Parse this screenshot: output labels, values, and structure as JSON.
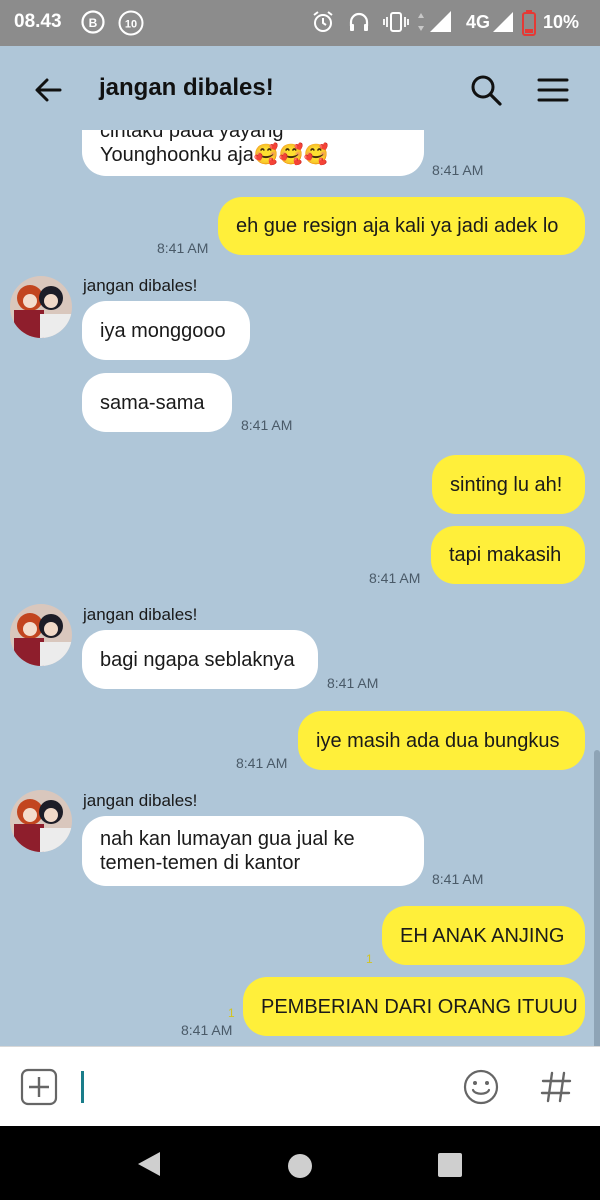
{
  "status_bar": {
    "time": "08.43",
    "badge_b": "B",
    "badge_count": "10",
    "network": "4G",
    "battery": "10%"
  },
  "header": {
    "title": "jangan dibales!"
  },
  "messages": {
    "m0": {
      "text_line1": "cintaku pada yayang",
      "text_line2": "Younghoonku aja🥰🥰🥰",
      "time": "8:41 AM"
    },
    "m1": {
      "text": "eh gue resign aja kali ya jadi adek lo",
      "time": "8:41 AM"
    },
    "m2": {
      "sender": "jangan dibales!",
      "text": "iya monggooo"
    },
    "m3": {
      "text": "sama-sama",
      "time": "8:41 AM"
    },
    "m4": {
      "text": "sinting lu ah!"
    },
    "m5": {
      "text": "tapi makasih",
      "time": "8:41 AM"
    },
    "m6": {
      "sender": "jangan dibales!",
      "text": "bagi ngapa seblaknya",
      "time": "8:41 AM"
    },
    "m7": {
      "text": "iye masih ada dua bungkus",
      "time": "8:41 AM"
    },
    "m8": {
      "sender": "jangan dibales!",
      "text_line1": "nah kan lumayan gua jual ke",
      "text_line2": "temen-temen di kantor",
      "time": "8:41 AM"
    },
    "m9": {
      "text": "EH ANAK ANJING",
      "read": "1"
    },
    "m10": {
      "text": "PEMBERIAN DARI ORANG ITUUU",
      "read": "1",
      "time": "8:41 AM"
    }
  },
  "input": {
    "value": ""
  },
  "colors": {
    "background": "#afc6d8",
    "sent_bubble": "#ffef3a",
    "received_bubble": "#ffffff",
    "status_bar": "#8c8c8c"
  },
  "icons": [
    "back-arrow-icon",
    "search-icon",
    "menu-icon",
    "add-icon",
    "emoji-icon",
    "hashtag-icon",
    "nav-back-icon",
    "nav-home-icon",
    "nav-recents-icon"
  ]
}
